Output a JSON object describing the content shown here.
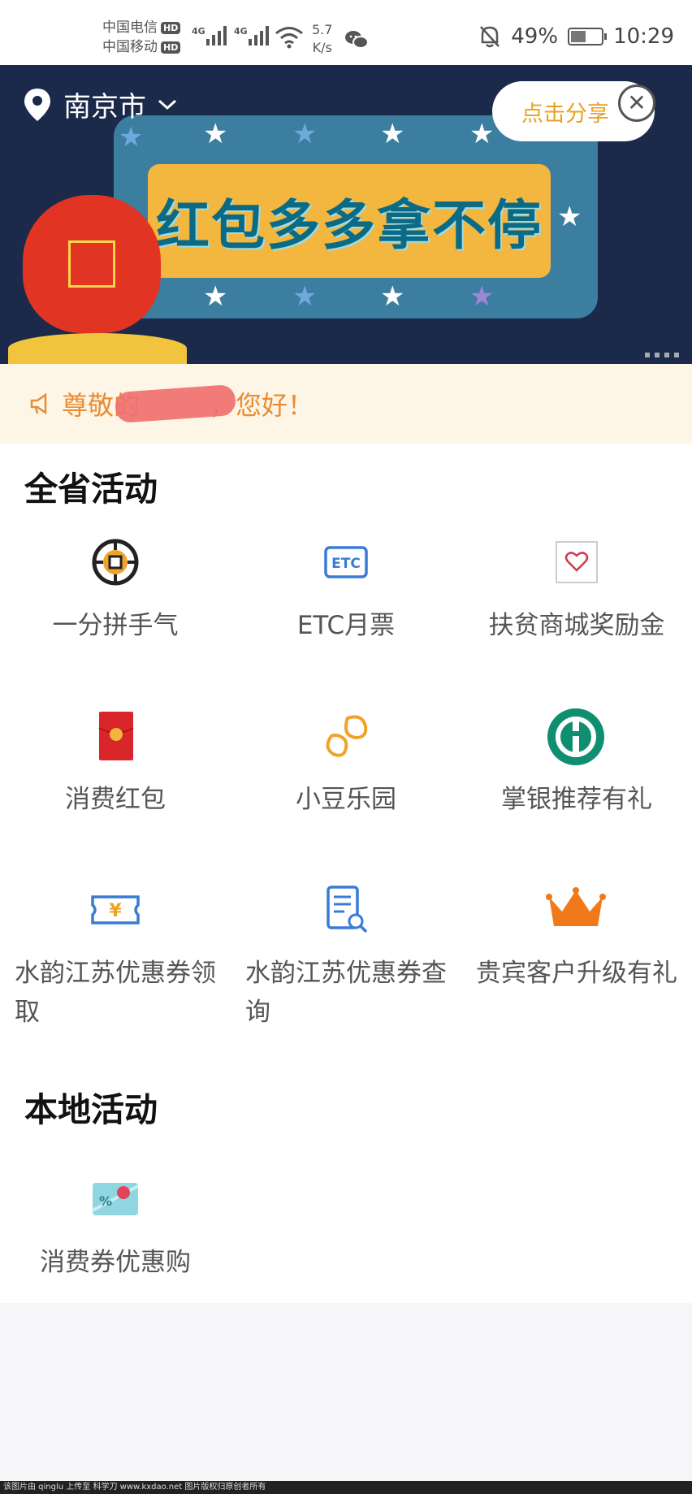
{
  "status_bar": {
    "carrier_1": "中国电信",
    "carrier_2": "中国移动",
    "hd_badge": "HD",
    "net_type": "4G",
    "speed_value": "5.7",
    "speed_unit": "K/s",
    "battery": "49%",
    "battery_level": 0.49,
    "time": "10:29"
  },
  "banner": {
    "city": "南京市",
    "share_label": "点击分享",
    "headline": "红包多多拿不停"
  },
  "notice": {
    "text_start": "尊敬的",
    "text_end": "，您好！"
  },
  "sections": {
    "province_title": "全省活动",
    "local_title": "本地活动"
  },
  "province_activities": [
    {
      "label": "一分拼手气",
      "icon": "coin-icon"
    },
    {
      "label": "ETC月票",
      "icon": "etc-icon"
    },
    {
      "label": "扶贫商城奖励金",
      "icon": "heart-card-icon"
    },
    {
      "label": "消费红包",
      "icon": "red-envelope-icon"
    },
    {
      "label": "小豆乐园",
      "icon": "bean-icon"
    },
    {
      "label": "掌银推荐有礼",
      "icon": "bank-logo-icon"
    },
    {
      "label": "水韵江苏优惠券领取",
      "icon": "coupon-ticket-icon"
    },
    {
      "label": "水韵江苏优惠券查询",
      "icon": "document-search-icon"
    },
    {
      "label": "贵宾客户升级有礼",
      "icon": "crown-icon"
    }
  ],
  "local_activities": [
    {
      "label": "消费券优惠购",
      "icon": "discount-card-icon"
    }
  ],
  "footer": {
    "text": "该图片由 qinglu 上传至 科学刀 www.kxdao.net 图片版权归原创者所有"
  },
  "colors": {
    "accent_orange": "#ea8c34",
    "share_text": "#e7a21c",
    "icon_blue": "#3a7bd5",
    "bank_green": "#0f8f6f",
    "red_envelope": "#d9262b"
  }
}
